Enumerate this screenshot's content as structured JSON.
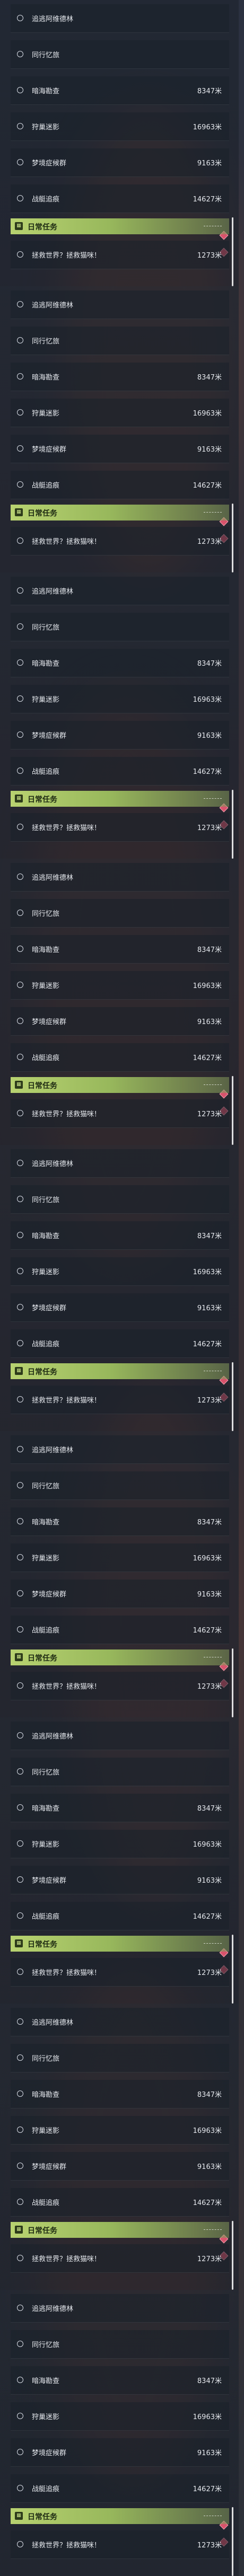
{
  "quest_list": {
    "items": [
      {
        "name": "追逃阿维德林",
        "reward": ""
      },
      {
        "name": "同行忆旅",
        "reward": ""
      },
      {
        "name": "暗海勘查",
        "reward": "8347米"
      },
      {
        "name": "狩巢迷影",
        "reward": "16963米"
      },
      {
        "name": "梦境症候群",
        "reward": "9163米"
      },
      {
        "name": "战艇追痕",
        "reward": "14627米"
      }
    ]
  },
  "daily_section": {
    "title": "日常任务",
    "icon": "calendar-icon",
    "items": [
      {
        "name": "拯救世界？拯救猫咪！",
        "reward": "1273米"
      }
    ]
  },
  "colors": {
    "section_accent": "#b8d270",
    "gem": "#d8536c",
    "text": "#e6e9ee"
  }
}
